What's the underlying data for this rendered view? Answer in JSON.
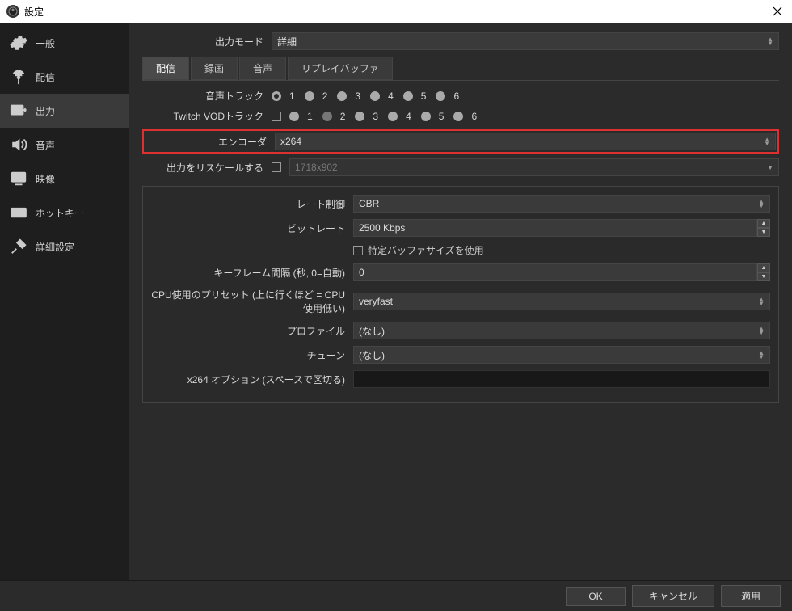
{
  "window": {
    "title": "設定"
  },
  "sidebar": {
    "items": [
      {
        "label": "一般"
      },
      {
        "label": "配信"
      },
      {
        "label": "出力"
      },
      {
        "label": "音声"
      },
      {
        "label": "映像"
      },
      {
        "label": "ホットキー"
      },
      {
        "label": "詳細設定"
      }
    ]
  },
  "output_mode": {
    "label": "出力モード",
    "value": "詳細"
  },
  "tabs": {
    "t0": "配信",
    "t1": "録画",
    "t2": "音声",
    "t3": "リプレイバッファ"
  },
  "audio_tracks": {
    "label": "音声トラック",
    "n1": "1",
    "n2": "2",
    "n3": "3",
    "n4": "4",
    "n5": "5",
    "n6": "6"
  },
  "vod_tracks": {
    "label": "Twitch VODトラック",
    "n1": "1",
    "n2": "2",
    "n3": "3",
    "n4": "4",
    "n5": "5",
    "n6": "6"
  },
  "encoder": {
    "label": "エンコーダ",
    "value": "x264"
  },
  "rescale": {
    "label": "出力をリスケールする",
    "value": "1718x902"
  },
  "rate_control": {
    "label": "レート制御",
    "value": "CBR"
  },
  "bitrate": {
    "label": "ビットレート",
    "value": "2500 Kbps"
  },
  "buffer_size": {
    "label": "特定バッファサイズを使用"
  },
  "keyframe": {
    "label": "キーフレーム間隔 (秒, 0=自動)",
    "value": "0"
  },
  "cpu_preset": {
    "label": "CPU使用のプリセット (上に行くほど = CPU使用低い)",
    "value": "veryfast"
  },
  "profile": {
    "label": "プロファイル",
    "value": "(なし)"
  },
  "tune": {
    "label": "チューン",
    "value": "(なし)"
  },
  "x264_opts": {
    "label": "x264 オプション (スペースで区切る)",
    "value": ""
  },
  "footer": {
    "ok": "OK",
    "cancel": "キャンセル",
    "apply": "適用"
  }
}
